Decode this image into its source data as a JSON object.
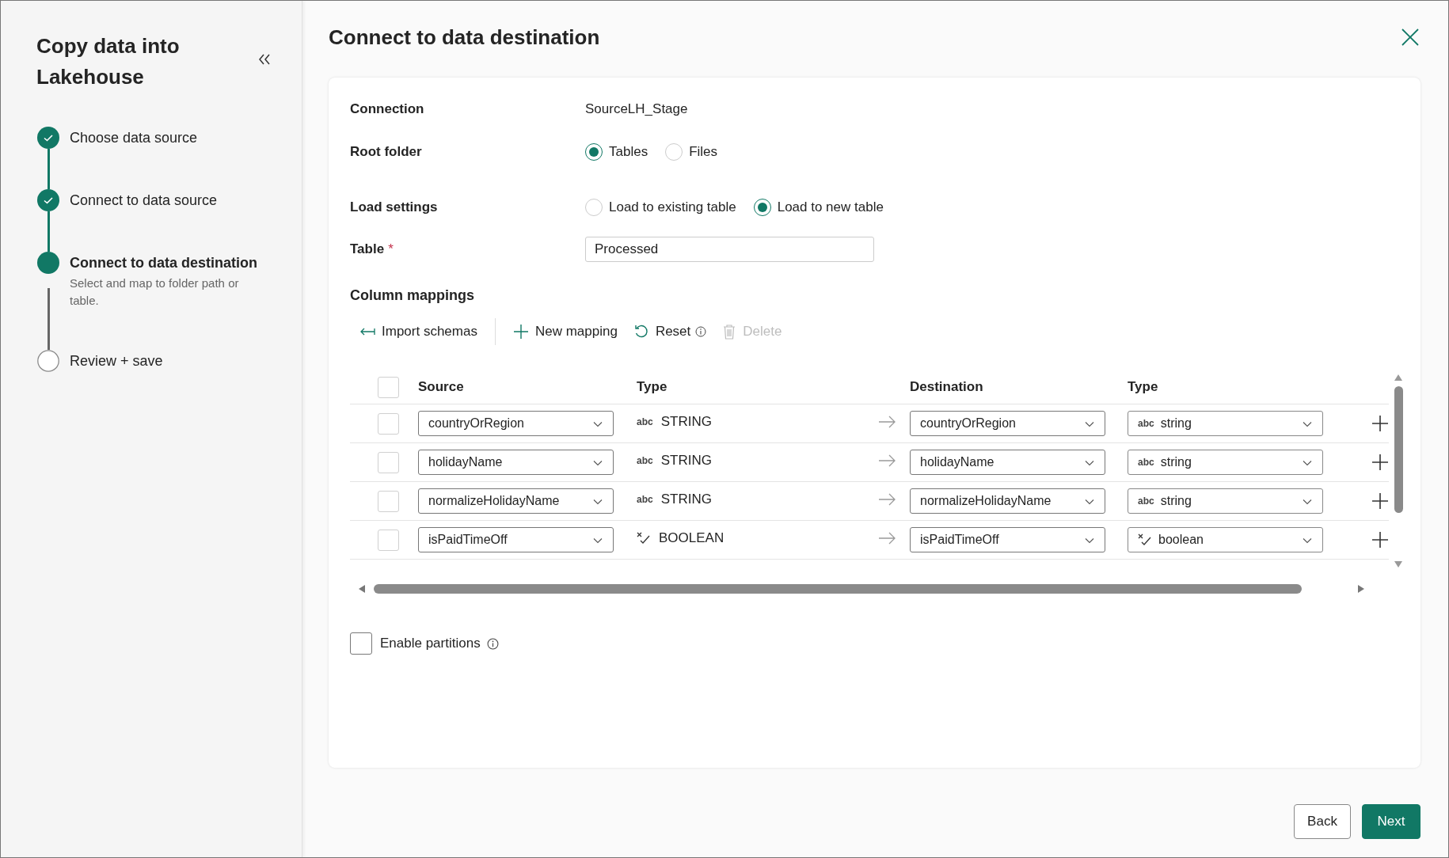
{
  "sidebar": {
    "title": "Copy data into Lakehouse",
    "steps": [
      {
        "label": "Choose data source",
        "completed": true,
        "current": false
      },
      {
        "label": "Connect to data source",
        "completed": true,
        "current": false
      },
      {
        "label": "Connect to data destination",
        "description": "Select and map to folder path or table.",
        "completed": false,
        "current": true
      },
      {
        "label": "Review + save",
        "completed": false,
        "current": false
      }
    ]
  },
  "dialog": {
    "title": "Connect to data destination"
  },
  "form": {
    "connection": {
      "label": "Connection",
      "value": "SourceLH_Stage"
    },
    "root_folder": {
      "label": "Root folder",
      "options": [
        {
          "label": "Tables",
          "selected": true
        },
        {
          "label": "Files",
          "selected": false
        }
      ]
    },
    "load_settings": {
      "label": "Load settings",
      "options": [
        {
          "label": "Load to existing table",
          "selected": false
        },
        {
          "label": "Load to new table",
          "selected": true
        }
      ]
    },
    "table": {
      "label": "Table",
      "required_mark": "*",
      "value": "Processed"
    }
  },
  "column_mappings": {
    "title": "Column mappings",
    "toolbar": [
      {
        "label": "Import schemas",
        "kind": "import",
        "disabled": false,
        "info": false
      },
      {
        "label": "New mapping",
        "kind": "add",
        "disabled": false,
        "info": false
      },
      {
        "label": "Reset",
        "kind": "reset",
        "disabled": false,
        "info": true
      },
      {
        "label": "Delete",
        "kind": "delete",
        "disabled": true,
        "info": false
      }
    ],
    "select_all": {
      "checked": false
    },
    "columns": [
      "Source",
      "Type",
      "Destination",
      "Type"
    ],
    "rows": [
      {
        "checked": false,
        "source": "countryOrRegion",
        "source_type": {
          "kind": "text",
          "icon": "abc",
          "label": "STRING"
        },
        "destination": "countryOrRegion",
        "destination_type": {
          "kind": "text",
          "icon": "abc",
          "label": "string"
        }
      },
      {
        "checked": false,
        "source": "holidayName",
        "source_type": {
          "kind": "text",
          "icon": "abc",
          "label": "STRING"
        },
        "destination": "holidayName",
        "destination_type": {
          "kind": "text",
          "icon": "abc",
          "label": "string"
        }
      },
      {
        "checked": false,
        "source": "normalizeHolidayName",
        "source_type": {
          "kind": "text",
          "icon": "abc",
          "label": "STRING"
        },
        "destination": "normalizeHolidayName",
        "destination_type": {
          "kind": "text",
          "icon": "abc",
          "label": "string"
        }
      },
      {
        "checked": false,
        "source": "isPaidTimeOff",
        "source_type": {
          "kind": "boolean",
          "label": "BOOLEAN"
        },
        "destination": "isPaidTimeOff",
        "destination_type": {
          "kind": "boolean",
          "label": "boolean"
        }
      }
    ]
  },
  "enable_partitions": {
    "label": "Enable partitions",
    "checked": false,
    "info": true
  },
  "buttons": [
    {
      "label": "Back",
      "kind": "secondary"
    },
    {
      "label": "Next",
      "kind": "primary"
    }
  ]
}
